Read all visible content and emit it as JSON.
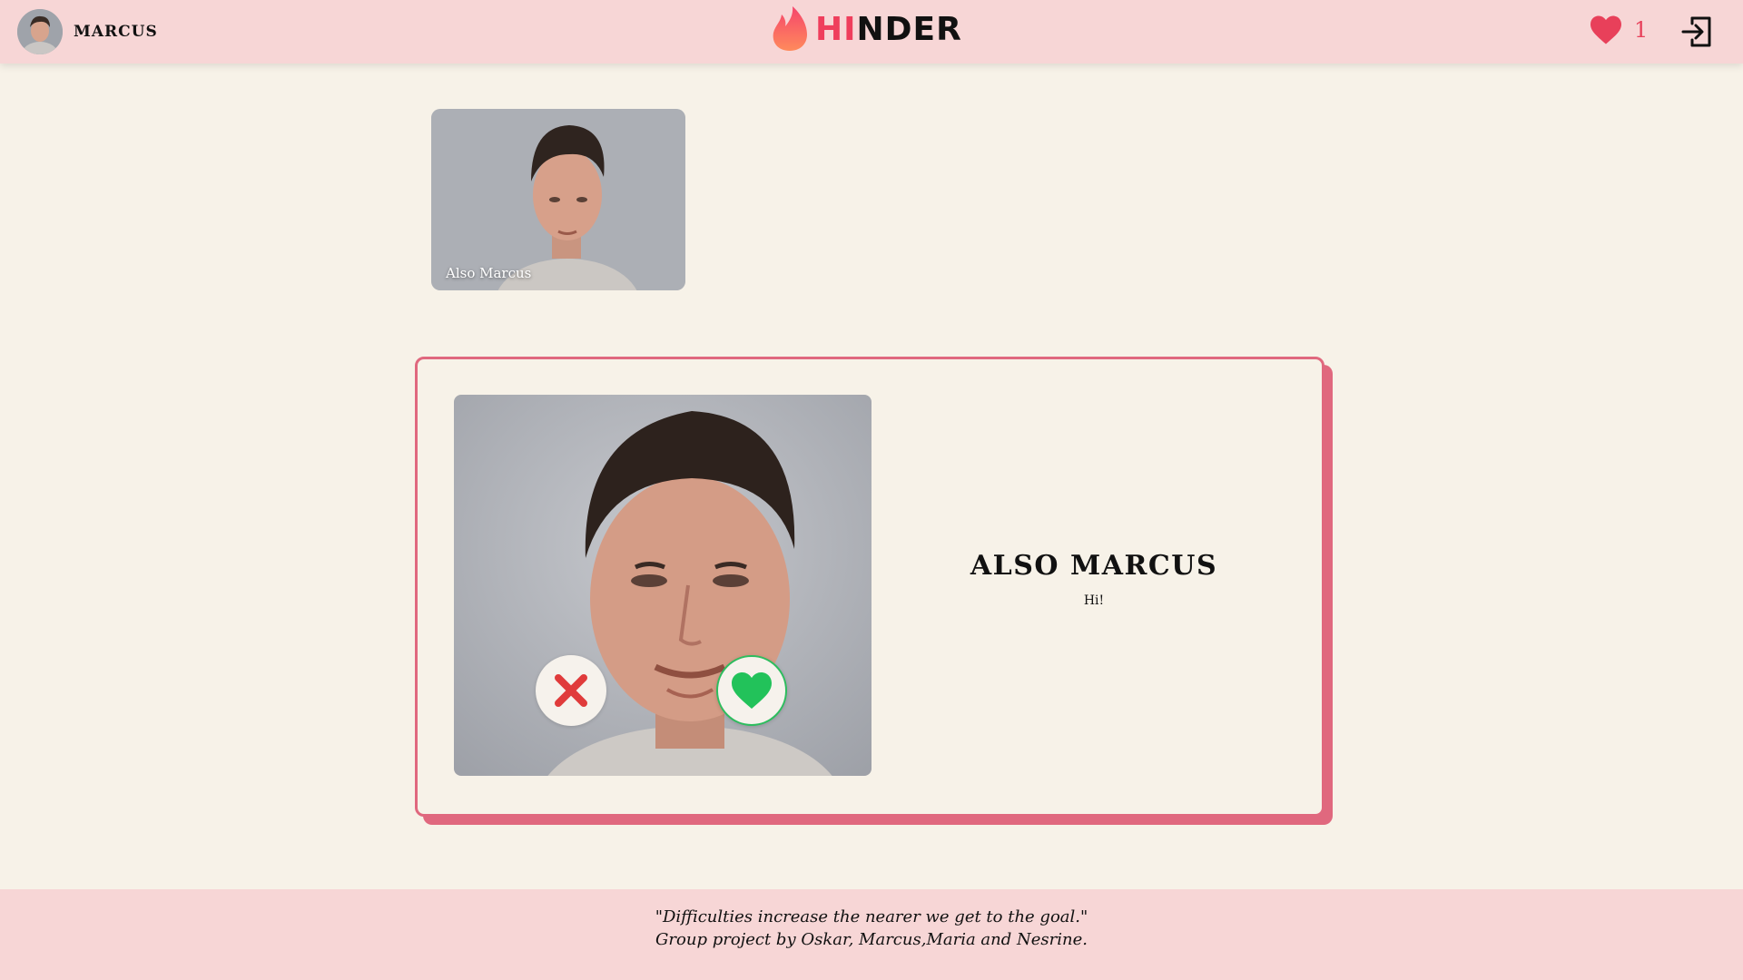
{
  "header": {
    "username": "MARCUS",
    "logo_hi": "HI",
    "logo_rest": "NDER",
    "likes_count": "1"
  },
  "matches": [
    {
      "name": "Also Marcus"
    }
  ],
  "profile": {
    "name": "ALSO MARCUS",
    "bio": "Hi!"
  },
  "footer": {
    "quote": "\"Difficulties increase the nearer we get to the goal.\"",
    "credits": "Group project by Oskar, Marcus,Maria and Nesrine."
  },
  "colors": {
    "brand": "#ef3e5c",
    "card_border": "#e0687e",
    "header_bg": "#f7d6d6",
    "page_bg": "#f7f2e8",
    "like_green": "#2dbd5e",
    "dislike_red": "#e03b3b"
  },
  "icons": [
    "flame-icon",
    "heart-icon",
    "logout-icon",
    "close-icon",
    "heart-icon"
  ]
}
